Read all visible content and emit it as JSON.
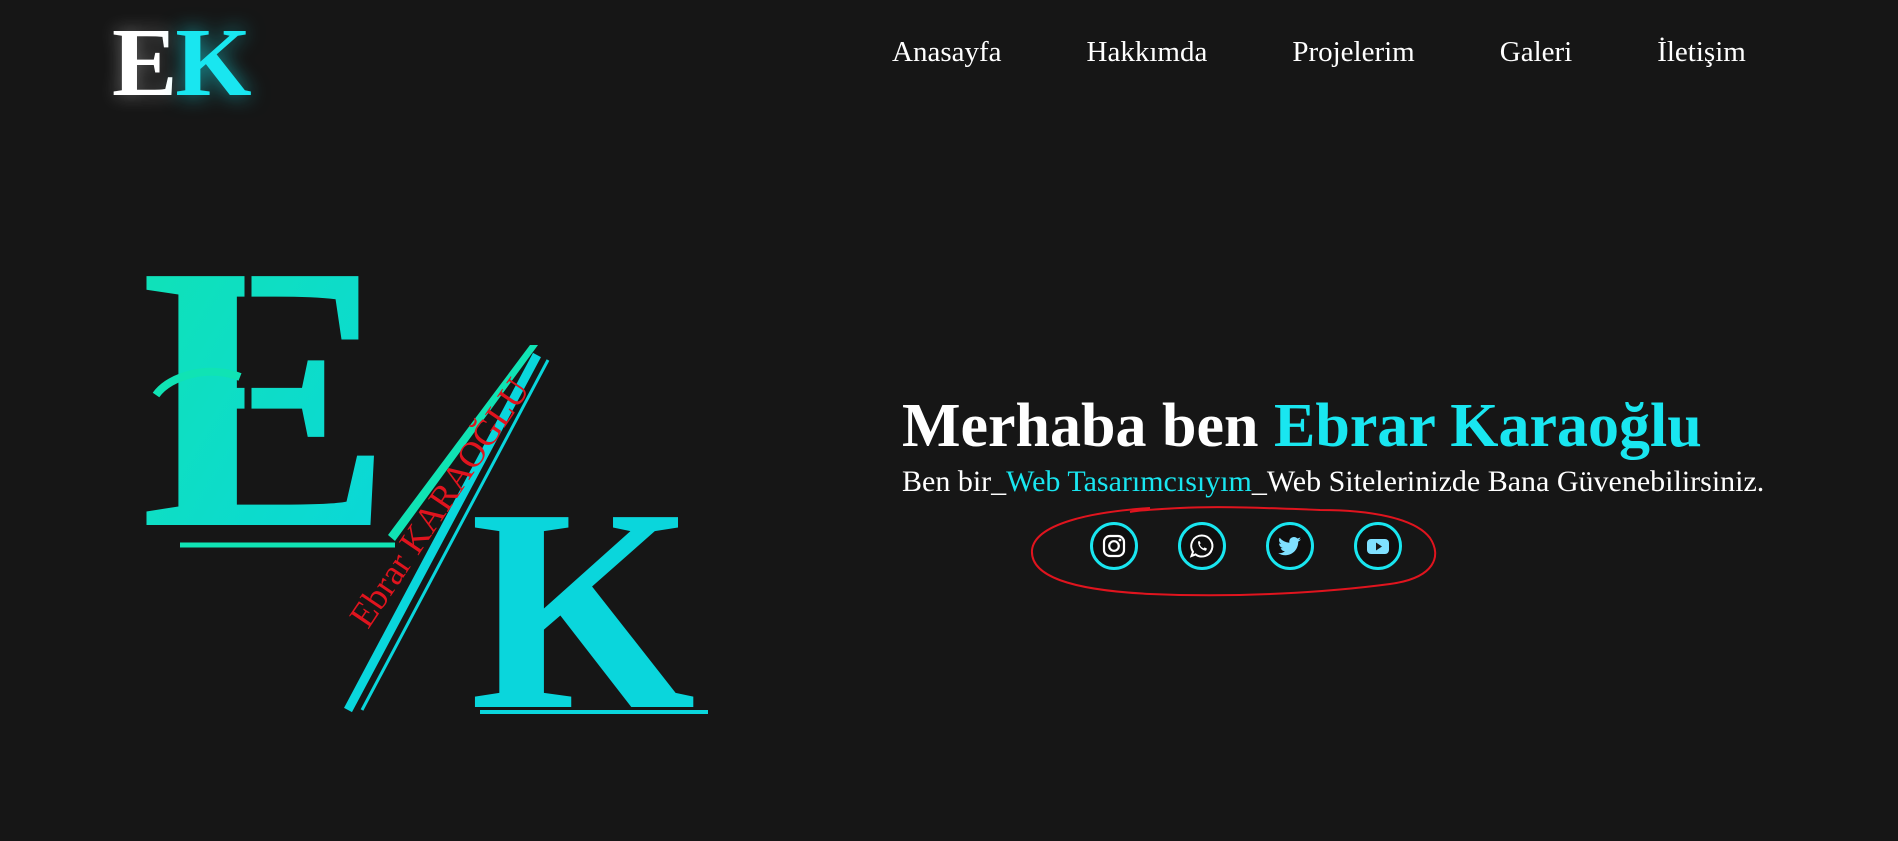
{
  "header": {
    "brand_e": "E",
    "brand_k": "K",
    "nav": [
      "Anasayfa",
      "Hakkımda",
      "Projelerim",
      "Galeri",
      "İletişim"
    ]
  },
  "logo": {
    "letter_e": "E",
    "letter_k": "K",
    "signature": "Ebrar KARAOĞLU"
  },
  "hero": {
    "greeting": "Merhaba ben ",
    "name": "Ebrar Karaoğlu",
    "intro_before": "Ben bir_",
    "role": "Web Tasarımcısıyım",
    "intro_after": "_Web Sitelerinizde Bana Güvenebilirsiniz."
  },
  "socials": [
    {
      "icon": "instagram-icon"
    },
    {
      "icon": "whatsapp-icon"
    },
    {
      "icon": "twitter-icon"
    },
    {
      "icon": "youtube-icon"
    }
  ],
  "colors": {
    "background": "#161616",
    "accent": "#19e6f0",
    "logo_teal": "#0fe0c0",
    "signature_red": "#e0141e",
    "scribble_red": "#e0141e"
  }
}
